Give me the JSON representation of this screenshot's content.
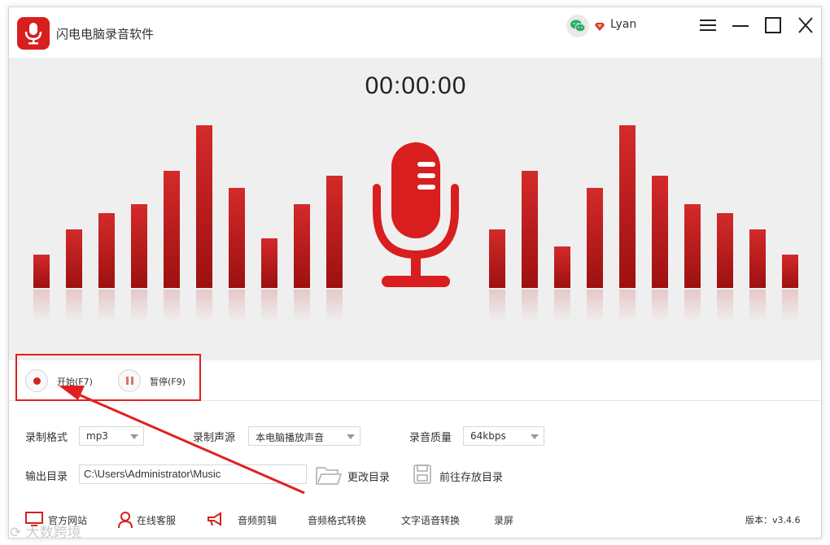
{
  "app": {
    "title": "闪电电脑录音软件",
    "username": "Lyan"
  },
  "icons": {
    "logo": "microphone-logo-icon",
    "wechat": "wechat-icon",
    "vip": "diamond-vip-icon",
    "menu": "hamburger-menu-icon",
    "minimize": "minimize-icon",
    "maximize": "maximize-icon",
    "close": "close-icon"
  },
  "timer": "00:00:00",
  "controls": {
    "start_label": "开始(F7)",
    "pause_label": "暂停(F9)"
  },
  "settings": {
    "format_label": "录制格式",
    "format_value": "mp3",
    "source_label": "录制声源",
    "source_value": "本电脑播放声音",
    "quality_label": "录音质量",
    "quality_value": "64kbps",
    "output_label": "输出目录",
    "output_path": "C:\\Users\\Administrator\\Music",
    "change_dir_label": "更改目录",
    "open_dir_label": "前往存放目录"
  },
  "footer": {
    "website": "官方网站",
    "support": "在线客服",
    "audio_edit": "音频剪辑",
    "format_convert": "音频格式转换",
    "tts": "文字语音转换",
    "screen_record": "录屏",
    "version": "版本：v3.4.6"
  },
  "watermark": "⟳ 大数跨境",
  "colors": {
    "accent": "#d81e1e",
    "bar_top": "#d42a2a",
    "bar_bottom": "#9d1010",
    "hero_bg": "#efefef"
  }
}
